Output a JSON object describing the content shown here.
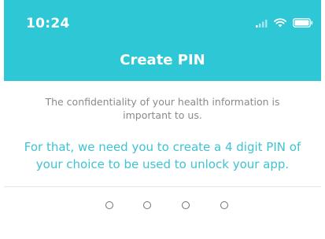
{
  "status_bar": {
    "time": "10:24",
    "icons": [
      "signal-icon",
      "wifi-icon",
      "battery-icon"
    ]
  },
  "header": {
    "title": "Create PIN",
    "background": "#2ec7d6"
  },
  "notice": {
    "text": "The confidentiality of your health information is important to us."
  },
  "instruction": {
    "text": "For that, we need you to create a 4 digit PIN of your choice to be used to unlock your app.",
    "color": "#3fc3d3"
  },
  "pin": {
    "length": 4,
    "entered": 0
  }
}
